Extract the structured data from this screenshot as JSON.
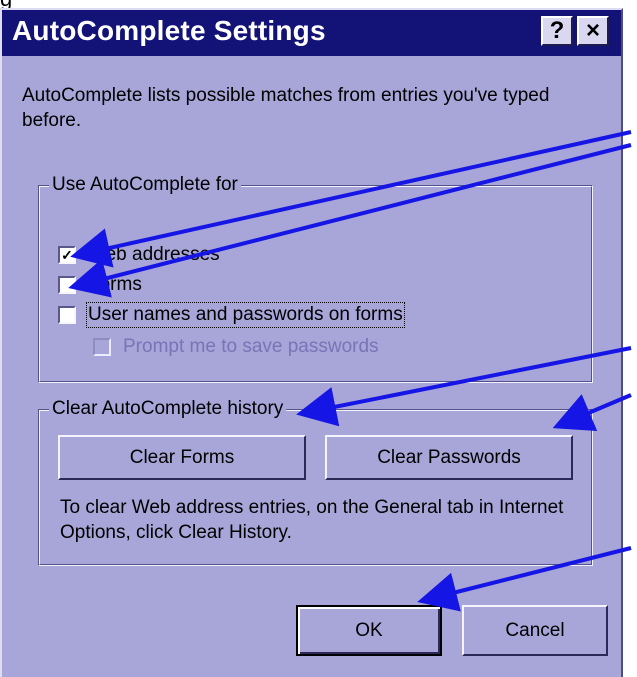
{
  "dialog": {
    "title": "AutoComplete Settings",
    "help_button": "?",
    "close_button": "×",
    "description": "AutoComplete lists possible matches from entries you've typed before."
  },
  "use_autocomplete": {
    "legend": "Use AutoComplete for",
    "items": [
      {
        "label": "Web addresses",
        "checked": true,
        "enabled": true
      },
      {
        "label": "Forms",
        "checked": false,
        "enabled": true
      },
      {
        "label": "User names and passwords on forms",
        "checked": false,
        "enabled": true
      },
      {
        "label": "Prompt me to save passwords",
        "checked": false,
        "enabled": false
      }
    ]
  },
  "clear_history": {
    "legend": "Clear AutoComplete history",
    "clear_forms": "Clear Forms",
    "clear_passwords": "Clear Passwords",
    "note": "To clear Web address entries, on the General tab in Internet Options, click Clear History."
  },
  "actions": {
    "ok": "OK",
    "cancel": "Cancel"
  },
  "colors": {
    "dialog_bg": "#a8a5d8",
    "titlebar": "#131377",
    "arrow": "#1515e6"
  }
}
